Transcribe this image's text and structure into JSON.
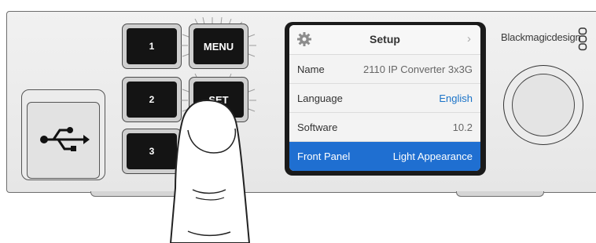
{
  "buttons": {
    "b1": "1",
    "b2": "2",
    "b3": "3",
    "menu": "MENU",
    "set": "SET"
  },
  "screen": {
    "title": "Setup",
    "icons": {
      "settings": "gear-icon",
      "next": "chevron-right-icon"
    },
    "rows": [
      {
        "label": "Name",
        "value": "2110 IP Converter 3x3G"
      },
      {
        "label": "Language",
        "value": "English"
      },
      {
        "label": "Software",
        "value": "10.2"
      },
      {
        "label": "Front Panel",
        "value": "Light Appearance"
      }
    ],
    "selected_row": "Front Panel"
  },
  "brand": {
    "text": "Blackmagicdesign"
  },
  "colors": {
    "selection": "#1f6fd1",
    "value_link": "#1a73c8",
    "button": "#141414",
    "panel": "#e9e9e9"
  },
  "icons": {
    "usb": "usb-icon",
    "knob": "search-dial",
    "logo": "blackmagic-logo-icon"
  }
}
